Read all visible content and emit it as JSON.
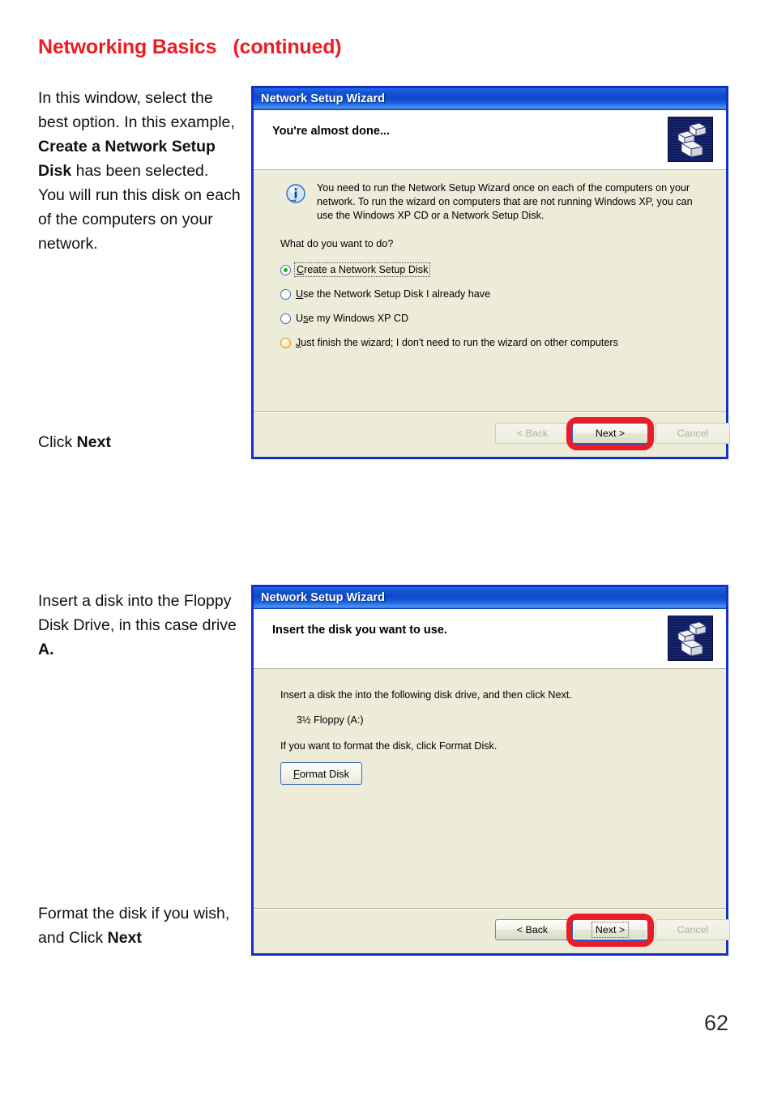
{
  "page": {
    "heading": "Networking Basics   (continued)",
    "heading_color": "#ed1c24",
    "number": "62"
  },
  "instructions": {
    "block1_part1": "In this window, select the best option.  In this example, ",
    "block1_bold1": "Create a Network Setup Disk",
    "block1_part2": " has been selected.\nYou will run this disk on each of the computers on your network.",
    "block2_plain": "Click ",
    "block2_bold": "Next",
    "block3_plain": "Insert a disk into the Floppy Disk Drive, in this case drive ",
    "block3_bold": "A.",
    "block4_plain": "Format the disk if you wish, and Click ",
    "block4_bold": "Next"
  },
  "wizard1": {
    "title": "Network Setup Wizard",
    "header_title": "You're almost done...",
    "icon": "network-computers-icon",
    "info_icon": "information-icon",
    "info_text": "You need to run the Network Setup Wizard once on each of the computers on your network. To run the wizard on computers that are not running Windows XP, you can use the Windows XP CD or a Network Setup Disk.",
    "question": "What do you want to do?",
    "options": [
      {
        "label_pre": "",
        "accel": "C",
        "label_post": "reate a Network Setup Disk",
        "state": "selected"
      },
      {
        "label_pre": "",
        "accel": "U",
        "label_post": "se the Network Setup Disk I already have",
        "state": "normal"
      },
      {
        "label_pre": "U",
        "accel": "s",
        "label_post": "e my Windows XP CD",
        "state": "normal"
      },
      {
        "label_pre": "",
        "accel": "J",
        "label_post": "ust finish the wizard; I don't need to run the wizard on other computers",
        "state": "hot"
      }
    ],
    "buttons": {
      "back": "< Back",
      "back_accel": "B",
      "next": "Next >",
      "next_accel": "N",
      "cancel": "Cancel",
      "back_enabled": false,
      "next_enabled": true,
      "cancel_enabled": false,
      "next_highlighted": true
    }
  },
  "wizard2": {
    "title": "Network Setup Wizard",
    "header_title": "Insert the disk you want to use.",
    "icon": "network-computers-icon",
    "line1": "Insert a disk the into the following disk drive, and then click Next.",
    "drive": "3½ Floppy (A:)",
    "line2": "If you want to format the disk, click Format Disk.",
    "format_button": "Format Disk",
    "format_button_accel": "F",
    "buttons": {
      "back": "< Back",
      "back_accel": "B",
      "next": "Next >",
      "next_accel": "N",
      "cancel": "Cancel",
      "back_enabled": true,
      "next_enabled": true,
      "cancel_enabled": false,
      "next_highlighted": true
    }
  },
  "colors": {
    "accent_red": "#ee1b24",
    "dialog_border_blue": "#1430c8",
    "dialog_body": "#ececd9",
    "titlebar_blue": "#0e48c9"
  }
}
